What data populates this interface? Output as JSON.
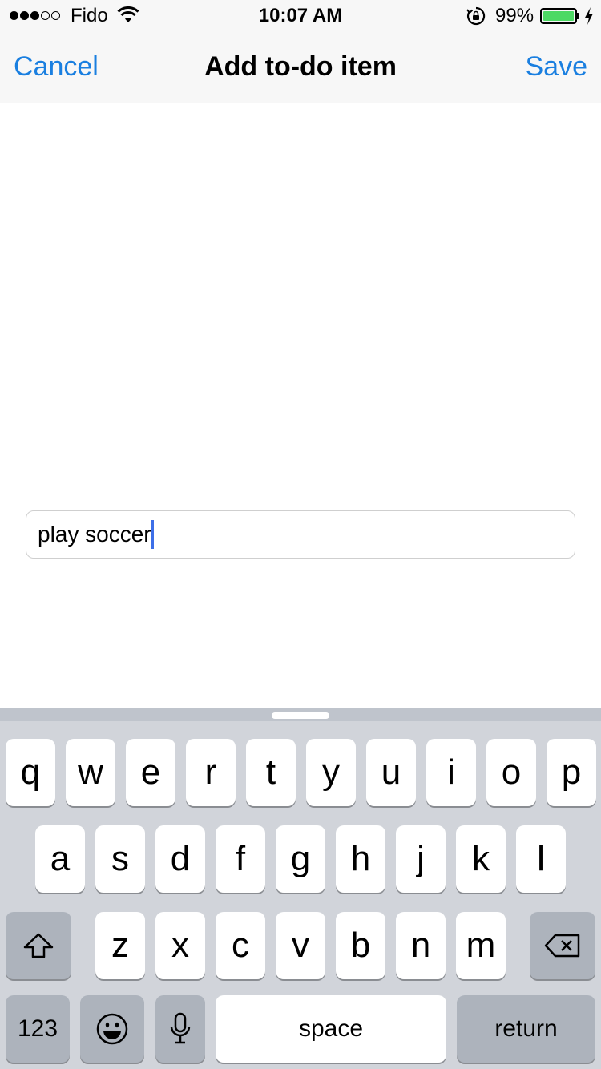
{
  "status_bar": {
    "carrier": "Fido",
    "time": "10:07 AM",
    "battery_percent": "99%",
    "battery_level": 0.99,
    "signal_bars_filled": 3,
    "signal_bars_total": 5,
    "icons": [
      "signal-dots-icon",
      "wifi-icon",
      "rotation-lock-icon",
      "battery-icon",
      "charging-bolt-icon"
    ]
  },
  "nav": {
    "cancel_label": "Cancel",
    "title": "Add to-do item",
    "save_label": "Save"
  },
  "todo_input": {
    "value": "play soccer",
    "placeholder": ""
  },
  "keyboard": {
    "row1": [
      "q",
      "w",
      "e",
      "r",
      "t",
      "y",
      "u",
      "i",
      "o",
      "p"
    ],
    "row2": [
      "a",
      "s",
      "d",
      "f",
      "g",
      "h",
      "j",
      "k",
      "l"
    ],
    "row3": [
      "z",
      "x",
      "c",
      "v",
      "b",
      "n",
      "m"
    ],
    "numbers_label": "123",
    "space_label": "space",
    "return_label": "return",
    "icons": [
      "shift-icon",
      "delete-icon",
      "emoji-icon",
      "microphone-icon"
    ]
  },
  "colors": {
    "accent": "#1a7fe0",
    "battery_fill": "#4cd964",
    "caret": "#3d6fe8",
    "keyboard_bg": "#d1d4da",
    "dark_key": "#adb3bc"
  }
}
